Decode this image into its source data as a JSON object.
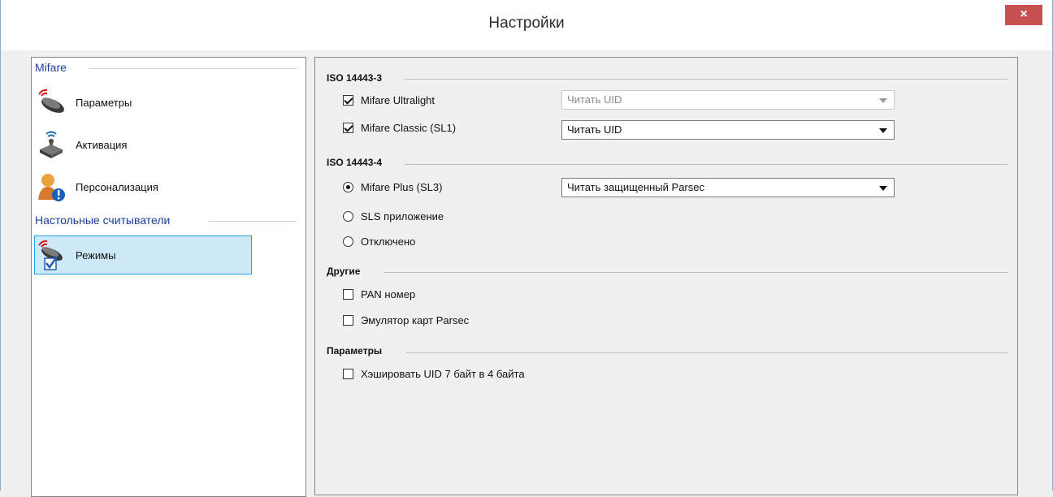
{
  "window": {
    "title": "Настройки",
    "close_symbol": "×"
  },
  "nav": {
    "groups": [
      {
        "label": "Mifare"
      },
      {
        "label": "Настольные считыватели"
      }
    ],
    "items": [
      {
        "label": "Параметры",
        "icon": "mifare-reader-icon"
      },
      {
        "label": "Активация",
        "icon": "activation-device-icon"
      },
      {
        "label": "Персонализация",
        "icon": "user-info-icon"
      },
      {
        "label": "Режимы",
        "icon": "modes-reader-icon",
        "selected": true
      }
    ]
  },
  "sections": {
    "iso3": {
      "title": "ISO 14443-3",
      "ultralight": {
        "label": "Mifare Ultralight",
        "checked": true,
        "select": "Читать UID",
        "select_disabled": true
      },
      "classic": {
        "label": "Mifare Classic (SL1)",
        "checked": true,
        "select": "Читать UID"
      }
    },
    "iso4": {
      "title": "ISO 14443-4",
      "plus": {
        "label": "Mifare Plus (SL3)",
        "selected": true,
        "select": "Читать защищенный Parsec"
      },
      "sls": {
        "label": "SLS приложение"
      },
      "off": {
        "label": "Отключено"
      }
    },
    "other": {
      "title": "Другие",
      "pan": {
        "label": "PAN номер",
        "checked": false
      },
      "emulator": {
        "label": "Эмулятор карт Parsec",
        "checked": false
      }
    },
    "params": {
      "title": "Параметры",
      "hash": {
        "label": "Хэшировать UID 7 байт в 4 байта",
        "checked": false
      }
    }
  },
  "colors": {
    "accent": "#26a0da",
    "selection_bg": "#cde8f7",
    "close_bg": "#c75050",
    "group_text": "#1a3e9c"
  }
}
